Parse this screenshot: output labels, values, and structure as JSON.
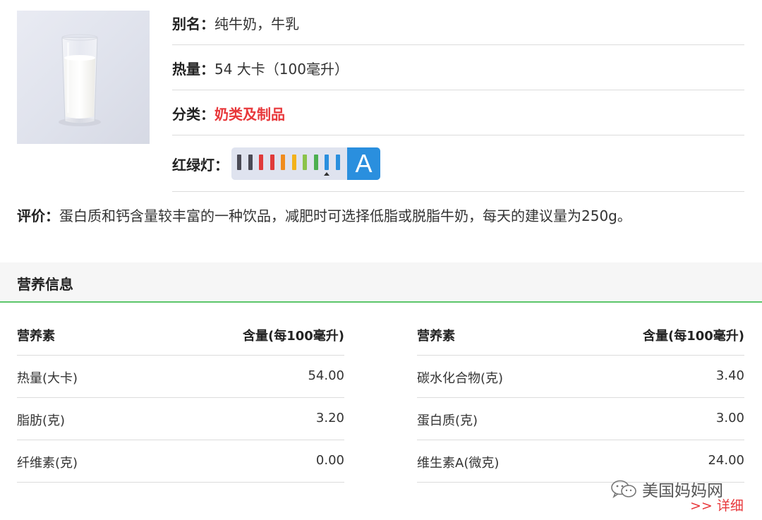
{
  "food": {
    "photo_alt": "glass-of-milk",
    "alias_label": "别名：",
    "alias_value": "纯牛奶，牛乳",
    "calorie_label": "热量：",
    "calorie_value": "54 大卡（100毫升）",
    "category_label": "分类：",
    "category_value": "奶类及制品",
    "traffic_label": "红绿灯：",
    "traffic_grade": "A",
    "traffic_colors": [
      "#4a4a55",
      "#4a4a55",
      "#e03a3a",
      "#e03a3a",
      "#f08c1e",
      "#f2b21b",
      "#8bc34a",
      "#4caf50",
      "#2a8fde",
      "#2a8fde"
    ],
    "traffic_level": 9,
    "comment_label": "评价：",
    "comment_value": "蛋白质和钙含量较丰富的一种饮品，减肥时可选择低脂或脱脂牛奶，每天的建议量为250g。"
  },
  "nutrition": {
    "section_title": "营养信息",
    "header_name": "营养素",
    "header_amount": "含量(每100毫升)",
    "left_rows": [
      {
        "name": "热量(大卡)",
        "value": "54.00"
      },
      {
        "name": "脂肪(克)",
        "value": "3.20"
      },
      {
        "name": "纤维素(克)",
        "value": "0.00"
      }
    ],
    "right_rows": [
      {
        "name": "碳水化合物(克)",
        "value": "3.40"
      },
      {
        "name": "蛋白质(克)",
        "value": "3.00"
      },
      {
        "name": "维生素A(微克)",
        "value": "24.00"
      }
    ]
  },
  "footer": {
    "wechat_name": "美国妈妈网",
    "detail_link": ">> 详细"
  }
}
